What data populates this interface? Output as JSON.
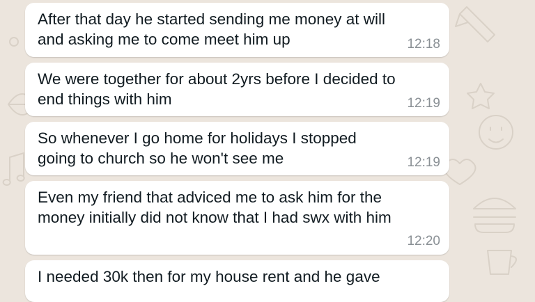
{
  "chat": {
    "messages": [
      {
        "lines": [
          "After that day he started sending me money at will",
          "and asking me to come meet him up"
        ],
        "time": "12:18"
      },
      {
        "lines": [
          "We were together for about 2yrs before I decided to",
          "end things with him"
        ],
        "time": "12:19"
      },
      {
        "lines": [
          "So whenever I go home for holidays I stopped",
          "going to church so he won't see me"
        ],
        "time": "12:19"
      },
      {
        "lines": [
          "Even my friend that adviced me to ask him for the",
          "money initially did not know that I had swx with him"
        ],
        "time": "12:20"
      },
      {
        "lines": [
          "I needed 30k then for my house rent and he gave"
        ],
        "time": ""
      }
    ]
  },
  "colors": {
    "wallpaper": "#ece5dd",
    "bubble": "#ffffff",
    "text": "#111b21",
    "timestamp": "#8a9095"
  }
}
